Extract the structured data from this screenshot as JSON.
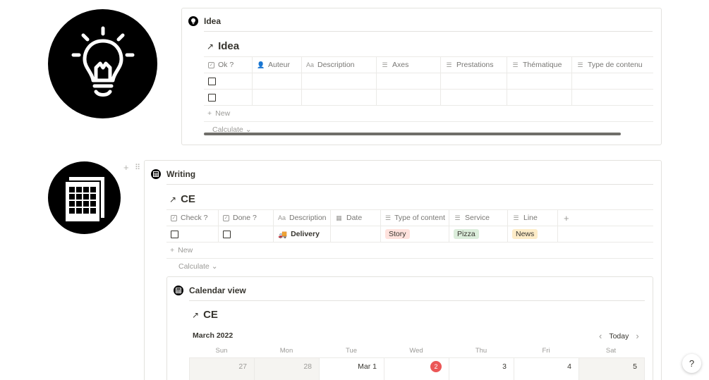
{
  "idea_block": {
    "heading": "Idea",
    "db_title": "Idea",
    "columns": [
      "Ok ?",
      "Auteur",
      "Description",
      "Axes",
      "Prestations",
      "Thématique",
      "Type de contenu"
    ],
    "new_label": "New",
    "calculate_label": "Calculate"
  },
  "writing_block": {
    "heading": "Writing",
    "db_title": "CE",
    "columns": [
      "Check ?",
      "Done ?",
      "Description",
      "Date",
      "Type of content",
      "Service",
      "Line"
    ],
    "row": {
      "description_emoji": "🚚",
      "description": "Delivery",
      "type_of_content": "Story",
      "service": "Pizza",
      "line": "News"
    },
    "new_label": "New",
    "calculate_label": "Calculate"
  },
  "calendar_block": {
    "heading": "Calendar view",
    "db_title": "CE",
    "month": "March 2022",
    "today_label": "Today",
    "weekdays": [
      "Sun",
      "Mon",
      "Tue",
      "Wed",
      "Thu",
      "Fri",
      "Sat"
    ],
    "days": [
      "27",
      "28",
      "Mar 1",
      "2",
      "3",
      "4",
      "5"
    ]
  },
  "help_label": "?",
  "colors": {
    "today": "#eb5757",
    "story_tag": "#ffe2dd",
    "pizza_tag": "#dbeddb",
    "news_tag": "#fdecc8"
  }
}
